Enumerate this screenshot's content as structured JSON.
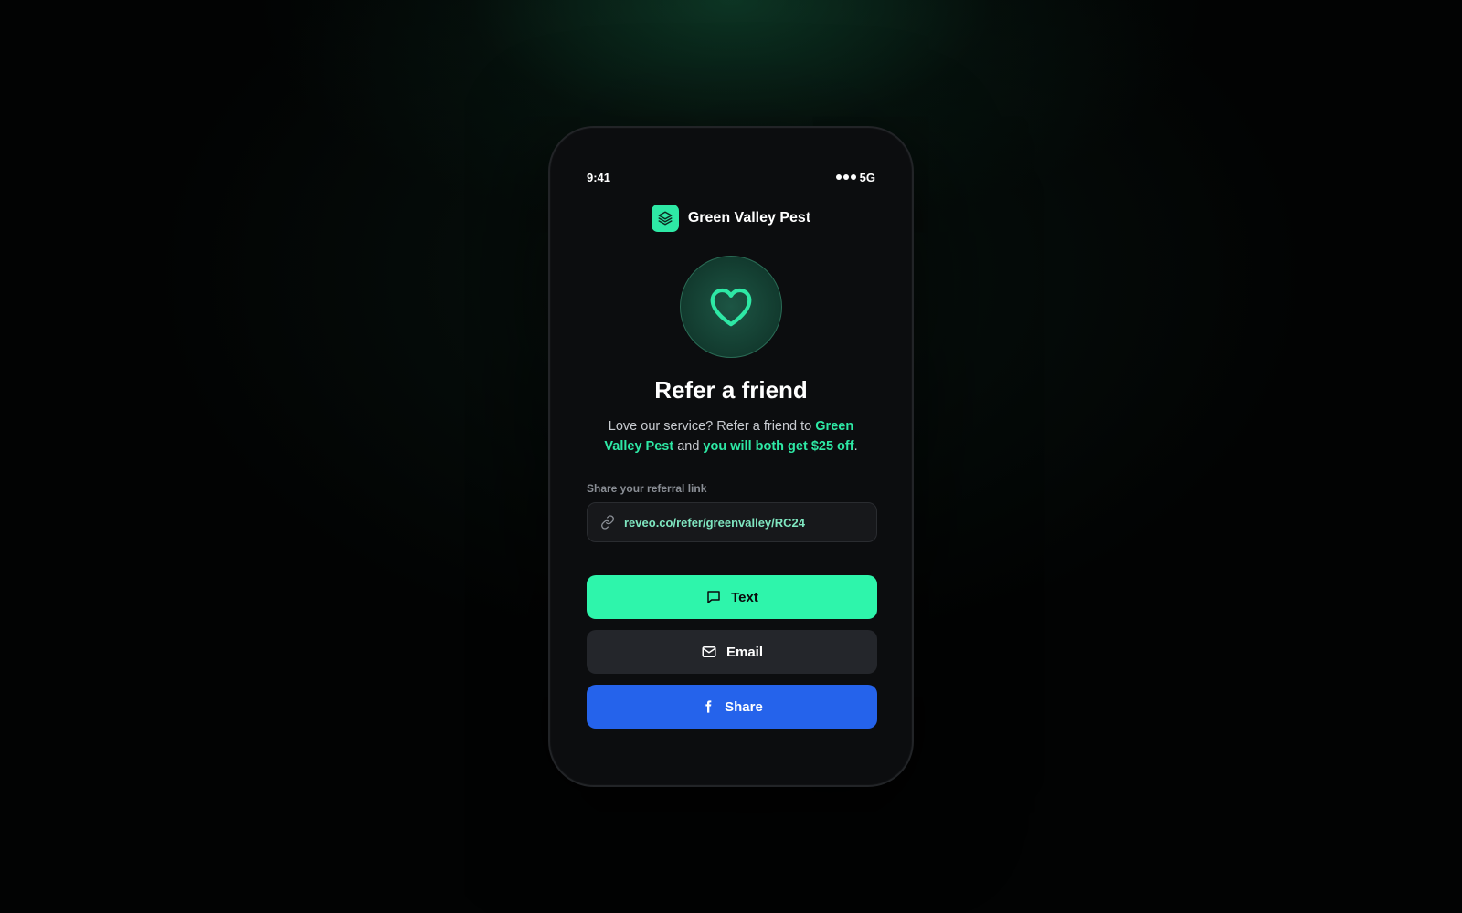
{
  "status_bar": {
    "time": "9:41",
    "network": "5G"
  },
  "brand": {
    "name": "Green Valley Pest",
    "logo_icon": "layers-icon"
  },
  "hero": {
    "icon": "heart-icon"
  },
  "title": "Refer a friend",
  "description": {
    "part1": "Love our service? Refer a friend to ",
    "highlight1": "Green Valley Pest",
    "part2": " and ",
    "highlight2": "you will both get $25 off",
    "part3": "."
  },
  "referral": {
    "label": "Share your referral link",
    "link": "reveo.co/refer/greenvalley/RC24",
    "icon": "link-icon"
  },
  "buttons": {
    "text": {
      "label": "Text",
      "icon": "message-icon"
    },
    "email": {
      "label": "Email",
      "icon": "mail-icon"
    },
    "share": {
      "label": "Share",
      "icon": "facebook-icon"
    }
  },
  "colors": {
    "accent": "#2ee8a5",
    "text_button": "#2ef5ab",
    "email_button": "#24262b",
    "share_button": "#2563eb",
    "screen_bg": "#0c0d0f"
  }
}
